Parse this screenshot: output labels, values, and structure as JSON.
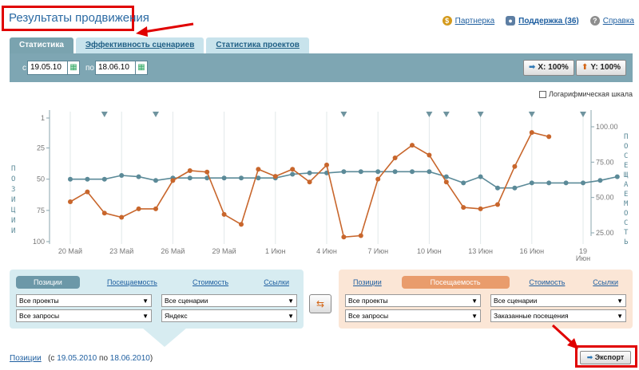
{
  "header": {
    "title": "Результаты продвижения",
    "links": [
      {
        "label": "Партнерка",
        "icon": "coin-icon"
      },
      {
        "label": "Поддержка (36)",
        "icon": "user-icon"
      },
      {
        "label": "Справка",
        "icon": "help-icon"
      }
    ]
  },
  "tabs": [
    "Статистика",
    "Эффективность сценариев",
    "Статистика проектов"
  ],
  "toolbar": {
    "from_label": "с",
    "from_value": "19.05.10",
    "to_label": "по",
    "to_value": "18.06.10",
    "zoom_x": "X: 100%",
    "zoom_y": "Y: 100%"
  },
  "log_scale_label": "Логарифмическая шкала",
  "chart_data": {
    "type": "line",
    "left_axis_label": "ПОЗИЦИИ",
    "right_axis_label": "ПОСЕЩАЕМОСТЬ",
    "left_ticks": [
      "1",
      "25",
      "50",
      "75",
      "100"
    ],
    "right_ticks": [
      "100.00",
      "75.00",
      "50.00",
      "25.00"
    ],
    "x_ticks": [
      "20 Май",
      "23 Май",
      "26 Май",
      "29 Май",
      "1 Июн",
      "4 Июн",
      "7 Июн",
      "10 Июн",
      "13 Июн",
      "16 Июн",
      "19 Июн"
    ],
    "markers": [
      2,
      5,
      16,
      21,
      22,
      24,
      27,
      30
    ],
    "colors": {
      "positions": "#5b8a98",
      "traffic": "#c8662c"
    },
    "series": [
      {
        "axis": "left",
        "values": [
          50,
          50,
          50,
          47,
          48,
          51,
          49,
          49,
          49,
          49,
          49,
          49,
          49,
          46,
          45,
          45,
          44,
          44,
          44,
          44,
          44,
          44,
          48,
          53,
          48,
          57,
          57,
          53,
          53,
          53,
          53,
          51,
          48
        ]
      },
      {
        "axis": "right",
        "values": [
          47,
          54,
          39,
          36,
          42,
          42,
          62,
          69,
          68,
          38,
          31,
          70,
          65,
          70,
          61,
          73,
          22,
          23,
          63,
          78,
          87,
          80,
          61,
          43,
          42,
          45,
          72,
          96,
          93
        ]
      }
    ]
  },
  "left_panel": {
    "tabs": [
      "Позиции",
      "Посещаемость",
      "Стоимость",
      "Ссылки"
    ],
    "select1": "Все проекты",
    "select2": "Все сценарии",
    "select3": "Все запросы",
    "select4": "Яндекс"
  },
  "right_panel": {
    "tabs": [
      "Позиции",
      "Посещаемость",
      "Стоимость",
      "Ссылки"
    ],
    "select1": "Все проекты",
    "select2": "Все сценарии",
    "select3": "Все запросы",
    "select4": "Заказанные посещения"
  },
  "footer": {
    "title": "Позиции",
    "open": "(с",
    "from": "19.05.2010",
    "mid": "по",
    "to": "18.06.2010",
    "close": ")"
  },
  "export_label": "Экспорт"
}
